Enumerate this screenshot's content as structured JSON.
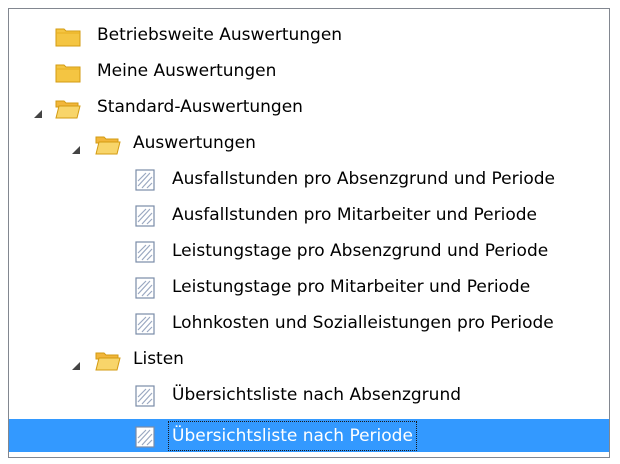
{
  "tree": {
    "items": [
      {
        "label": "Betriebsweite Auswertungen",
        "type": "folder",
        "expanded": false,
        "level": 0
      },
      {
        "label": "Meine Auswertungen",
        "type": "folder",
        "expanded": false,
        "level": 0
      },
      {
        "label": "Standard-Auswertungen",
        "type": "folder",
        "expanded": true,
        "level": 0
      },
      {
        "label": "Auswertungen",
        "type": "folder",
        "expanded": true,
        "level": 1
      },
      {
        "label": "Ausfallstunden pro Absenzgrund und Periode",
        "type": "report",
        "level": 2
      },
      {
        "label": "Ausfallstunden pro Mitarbeiter und Periode",
        "type": "report",
        "level": 2
      },
      {
        "label": "Leistungstage pro Absenzgrund und Periode",
        "type": "report",
        "level": 2
      },
      {
        "label": "Leistungstage pro Mitarbeiter und Periode",
        "type": "report",
        "level": 2
      },
      {
        "label": "Lohnkosten und Sozialleistungen pro Periode",
        "type": "report",
        "level": 2
      },
      {
        "label": "Listen",
        "type": "folder",
        "expanded": true,
        "level": 1
      },
      {
        "label": "Übersichtsliste nach Absenzgrund",
        "type": "report",
        "level": 2
      },
      {
        "label": "Übersichtsliste nach Periode",
        "type": "report",
        "level": 2,
        "selected": true
      }
    ]
  },
  "colors": {
    "selection": "#3399ff",
    "folder": "#f2c94c",
    "border": "#828790"
  },
  "icons": {
    "folder": "folder-icon",
    "report": "report-icon",
    "expanded_arrow": "expanded-arrow-icon"
  }
}
